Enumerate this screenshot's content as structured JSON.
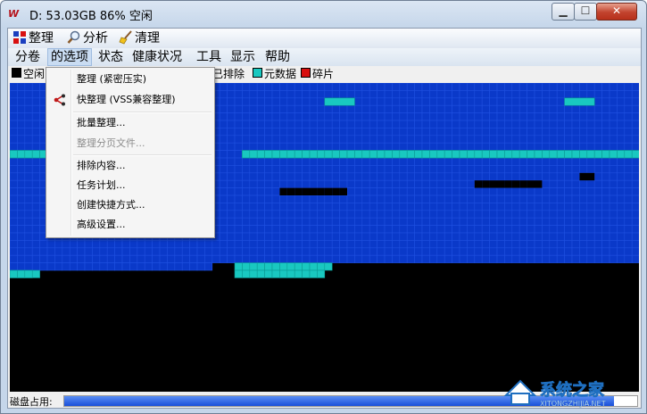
{
  "window": {
    "title": "D:  53.03GB 86% 空闲",
    "app_icon": "W"
  },
  "toolbar": {
    "defrag_label": "整理",
    "analyze_label": "分析",
    "clean_label": "清理"
  },
  "menubar": {
    "items": [
      "分卷",
      "的选项",
      "状态",
      "健康状况",
      "工具",
      "显示",
      "帮助"
    ]
  },
  "legend": {
    "free_label": "空闲",
    "excluded_label": "已排除",
    "metadata_label": "元数据",
    "fragmented_label": "碎片",
    "colors": {
      "free": "#000000",
      "used": "#0a39c9",
      "metadata": "#19c8c0",
      "fragmented": "#d81010"
    }
  },
  "dropdown": {
    "items": [
      {
        "label": "整理 (紧密压实)",
        "enabled": true
      },
      {
        "label": "快整理 (VSS兼容整理)",
        "enabled": true,
        "icon": "share-icon"
      },
      {
        "label": "批量整理...",
        "enabled": true
      },
      {
        "label": "整理分页文件...",
        "enabled": false
      },
      {
        "label": "排除内容...",
        "enabled": true
      },
      {
        "label": "任务计划...",
        "enabled": true
      },
      {
        "label": "创建快捷方式...",
        "enabled": true
      },
      {
        "label": "高级设置...",
        "enabled": true
      }
    ]
  },
  "status": {
    "disk_label": "磁盘占用:",
    "disk_usage_fraction": 0.96
  },
  "watermark": {
    "brand": "系统之家",
    "url": "XITONGZHIJIA.NET"
  }
}
